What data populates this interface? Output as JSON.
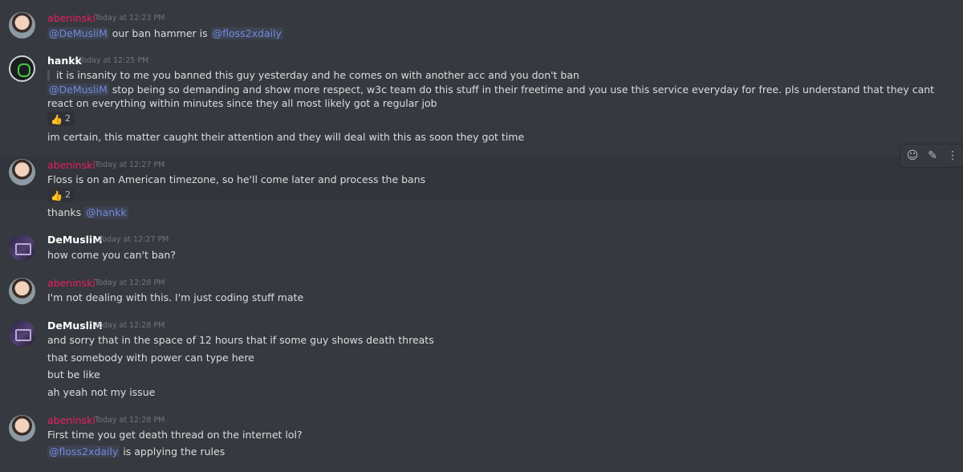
{
  "messages": [
    {
      "author": "abeninski",
      "timestamp": "Today at 12:23 PM",
      "mention1": "@DeMusliM",
      "text1": " our ban hammer is ",
      "mention2": "@floss2xdaily"
    },
    {
      "author": "hankk",
      "timestamp": "Today at 12:25 PM",
      "quote": "it is insanity to me you banned this guy yesterday and he comes on with another acc and you don't ban",
      "reply_mention": "@DeMusliM",
      "reply_text": " stop being so demanding and show more respect, w3c team do this stuff in their freetime and you use this service everyday for free. pls understand that they cant react on everything within minutes since they all most likely got a regular job",
      "reaction_count": "2",
      "followup": "im certain, this matter caught their attention and they will deal with this as soon they got time"
    },
    {
      "author": "abeninski",
      "timestamp": "Today at 12:27 PM",
      "text": "Floss is on an American timezone, so he'll come later and process the bans",
      "reaction_count": "2",
      "followup_text": "thanks ",
      "followup_mention": "@hankk"
    },
    {
      "author": "DeMusliM",
      "timestamp": "Today at 12:27 PM",
      "text": "how come you can't ban?"
    },
    {
      "author": "abeninski",
      "timestamp": "Today at 12:28 PM",
      "text": "I'm not dealing with this. I'm just coding stuff mate"
    },
    {
      "author": "DeMusliM",
      "timestamp": "Today at 12:28 PM",
      "lines": [
        "and sorry that in the space of 12 hours that if some guy shows death threats",
        "that somebody with power can type here",
        "but be like",
        "ah yeah not my issue"
      ]
    },
    {
      "author": "abeninski",
      "timestamp": "Today at 12:28 PM",
      "text": "First time you get death thread on the internet lol?",
      "mention": "@floss2xdaily",
      "text2": " is applying the rules"
    }
  ],
  "toolbar": {
    "icons": [
      "add-reaction-icon",
      "edit-icon",
      "more-icon"
    ]
  },
  "colors": {
    "background": "#36393f",
    "abeninski_name": "#e91e63",
    "mention": "#7289da",
    "timestamp": "#72767d"
  }
}
